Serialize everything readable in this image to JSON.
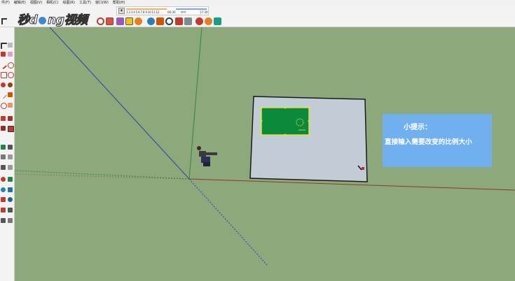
{
  "menu": [
    "件(F)",
    "编辑(E)",
    "视图(V)",
    "相机(C)",
    "绘图(R)",
    "工具(T)",
    "窗口(W)",
    "帮助(H)"
  ],
  "logo": {
    "part1": "秒d",
    "part2": "ng视频"
  },
  "shadow": {
    "toggle": "☀",
    "months": "1 2 3 4 5 6 7 8 9 10 11 12",
    "time_start": "06:30",
    "noon": "中午",
    "time_end": "17:30"
  },
  "hint": {
    "title": "小提示：",
    "body": "直接输入需要改变的比例大小"
  },
  "colors": {
    "ground": "#8da87b",
    "panel": "#c1ccd6",
    "green_rect": "#0a8a3a",
    "hint_bg": "#71b0ee"
  }
}
